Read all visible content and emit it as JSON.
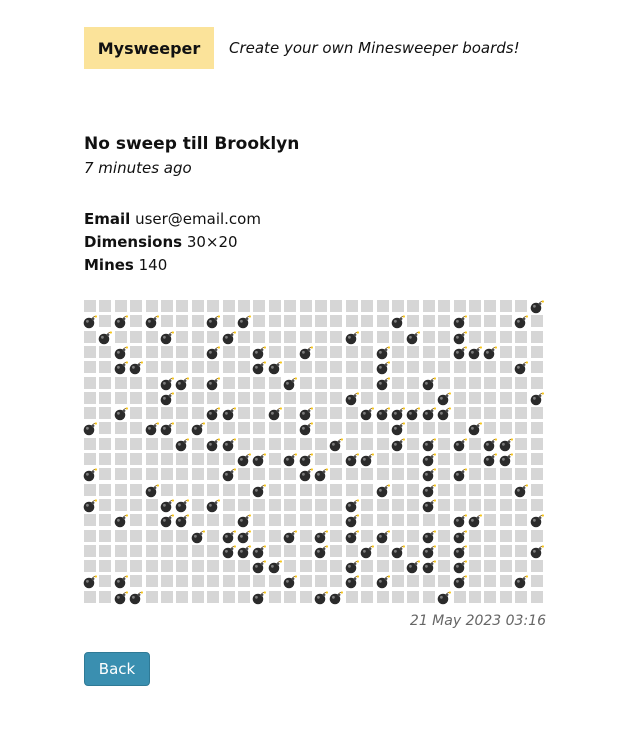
{
  "header": {
    "logo": "Mysweeper",
    "tagline": "Create your own Minesweeper boards!"
  },
  "board_info": {
    "title": "No sweep till Brooklyn",
    "created_ago": "7 minutes ago",
    "email_label": "Email",
    "email_value": "user@email.com",
    "dimensions_label": "Dimensions",
    "dimensions_value": "30×20",
    "mines_label": "Mines",
    "mines_value": "140",
    "timestamp": "21 May 2023 03:16"
  },
  "grid": {
    "columns": 30,
    "rows": 20,
    "mine_icon": "bomb-icon",
    "mines": [
      [
        0,
        29
      ],
      [
        1,
        0
      ],
      [
        1,
        2
      ],
      [
        1,
        4
      ],
      [
        1,
        8
      ],
      [
        1,
        10
      ],
      [
        1,
        20
      ],
      [
        1,
        24
      ],
      [
        1,
        28
      ],
      [
        2,
        1
      ],
      [
        2,
        5
      ],
      [
        2,
        9
      ],
      [
        2,
        17
      ],
      [
        2,
        21
      ],
      [
        2,
        24
      ],
      [
        3,
        2
      ],
      [
        3,
        8
      ],
      [
        3,
        11
      ],
      [
        3,
        14
      ],
      [
        3,
        19
      ],
      [
        3,
        24
      ],
      [
        3,
        25
      ],
      [
        3,
        26
      ],
      [
        4,
        2
      ],
      [
        4,
        3
      ],
      [
        4,
        11
      ],
      [
        4,
        12
      ],
      [
        4,
        19
      ],
      [
        4,
        28
      ],
      [
        5,
        5
      ],
      [
        5,
        6
      ],
      [
        5,
        8
      ],
      [
        5,
        13
      ],
      [
        5,
        19
      ],
      [
        5,
        22
      ],
      [
        6,
        5
      ],
      [
        6,
        17
      ],
      [
        6,
        23
      ],
      [
        6,
        29
      ],
      [
        7,
        2
      ],
      [
        7,
        8
      ],
      [
        7,
        9
      ],
      [
        7,
        12
      ],
      [
        7,
        14
      ],
      [
        7,
        18
      ],
      [
        7,
        19
      ],
      [
        7,
        20
      ],
      [
        7,
        21
      ],
      [
        7,
        22
      ],
      [
        7,
        23
      ],
      [
        8,
        0
      ],
      [
        8,
        4
      ],
      [
        8,
        5
      ],
      [
        8,
        7
      ],
      [
        8,
        14
      ],
      [
        8,
        20
      ],
      [
        8,
        25
      ],
      [
        9,
        6
      ],
      [
        9,
        8
      ],
      [
        9,
        9
      ],
      [
        9,
        16
      ],
      [
        9,
        20
      ],
      [
        9,
        22
      ],
      [
        9,
        24
      ],
      [
        9,
        26
      ],
      [
        9,
        27
      ],
      [
        10,
        10
      ],
      [
        10,
        11
      ],
      [
        10,
        13
      ],
      [
        10,
        14
      ],
      [
        10,
        17
      ],
      [
        10,
        18
      ],
      [
        10,
        22
      ],
      [
        10,
        26
      ],
      [
        10,
        27
      ],
      [
        11,
        0
      ],
      [
        11,
        9
      ],
      [
        11,
        14
      ],
      [
        11,
        15
      ],
      [
        11,
        22
      ],
      [
        11,
        24
      ],
      [
        12,
        4
      ],
      [
        12,
        11
      ],
      [
        12,
        19
      ],
      [
        12,
        22
      ],
      [
        12,
        28
      ],
      [
        13,
        0
      ],
      [
        13,
        5
      ],
      [
        13,
        6
      ],
      [
        13,
        8
      ],
      [
        13,
        17
      ],
      [
        13,
        22
      ],
      [
        14,
        2
      ],
      [
        14,
        5
      ],
      [
        14,
        6
      ],
      [
        14,
        10
      ],
      [
        14,
        17
      ],
      [
        14,
        24
      ],
      [
        14,
        25
      ],
      [
        14,
        29
      ],
      [
        15,
        7
      ],
      [
        15,
        9
      ],
      [
        15,
        10
      ],
      [
        15,
        13
      ],
      [
        15,
        15
      ],
      [
        15,
        17
      ],
      [
        15,
        19
      ],
      [
        15,
        22
      ],
      [
        15,
        24
      ],
      [
        16,
        9
      ],
      [
        16,
        10
      ],
      [
        16,
        11
      ],
      [
        16,
        15
      ],
      [
        16,
        18
      ],
      [
        16,
        20
      ],
      [
        16,
        22
      ],
      [
        16,
        24
      ],
      [
        16,
        29
      ],
      [
        17,
        11
      ],
      [
        17,
        12
      ],
      [
        17,
        17
      ],
      [
        17,
        21
      ],
      [
        17,
        22
      ],
      [
        17,
        24
      ],
      [
        18,
        0
      ],
      [
        18,
        2
      ],
      [
        18,
        13
      ],
      [
        18,
        17
      ],
      [
        18,
        19
      ],
      [
        18,
        24
      ],
      [
        18,
        28
      ],
      [
        19,
        2
      ],
      [
        19,
        3
      ],
      [
        19,
        11
      ],
      [
        19,
        15
      ],
      [
        19,
        16
      ],
      [
        19,
        23
      ]
    ]
  },
  "actions": {
    "back_label": "Back"
  }
}
